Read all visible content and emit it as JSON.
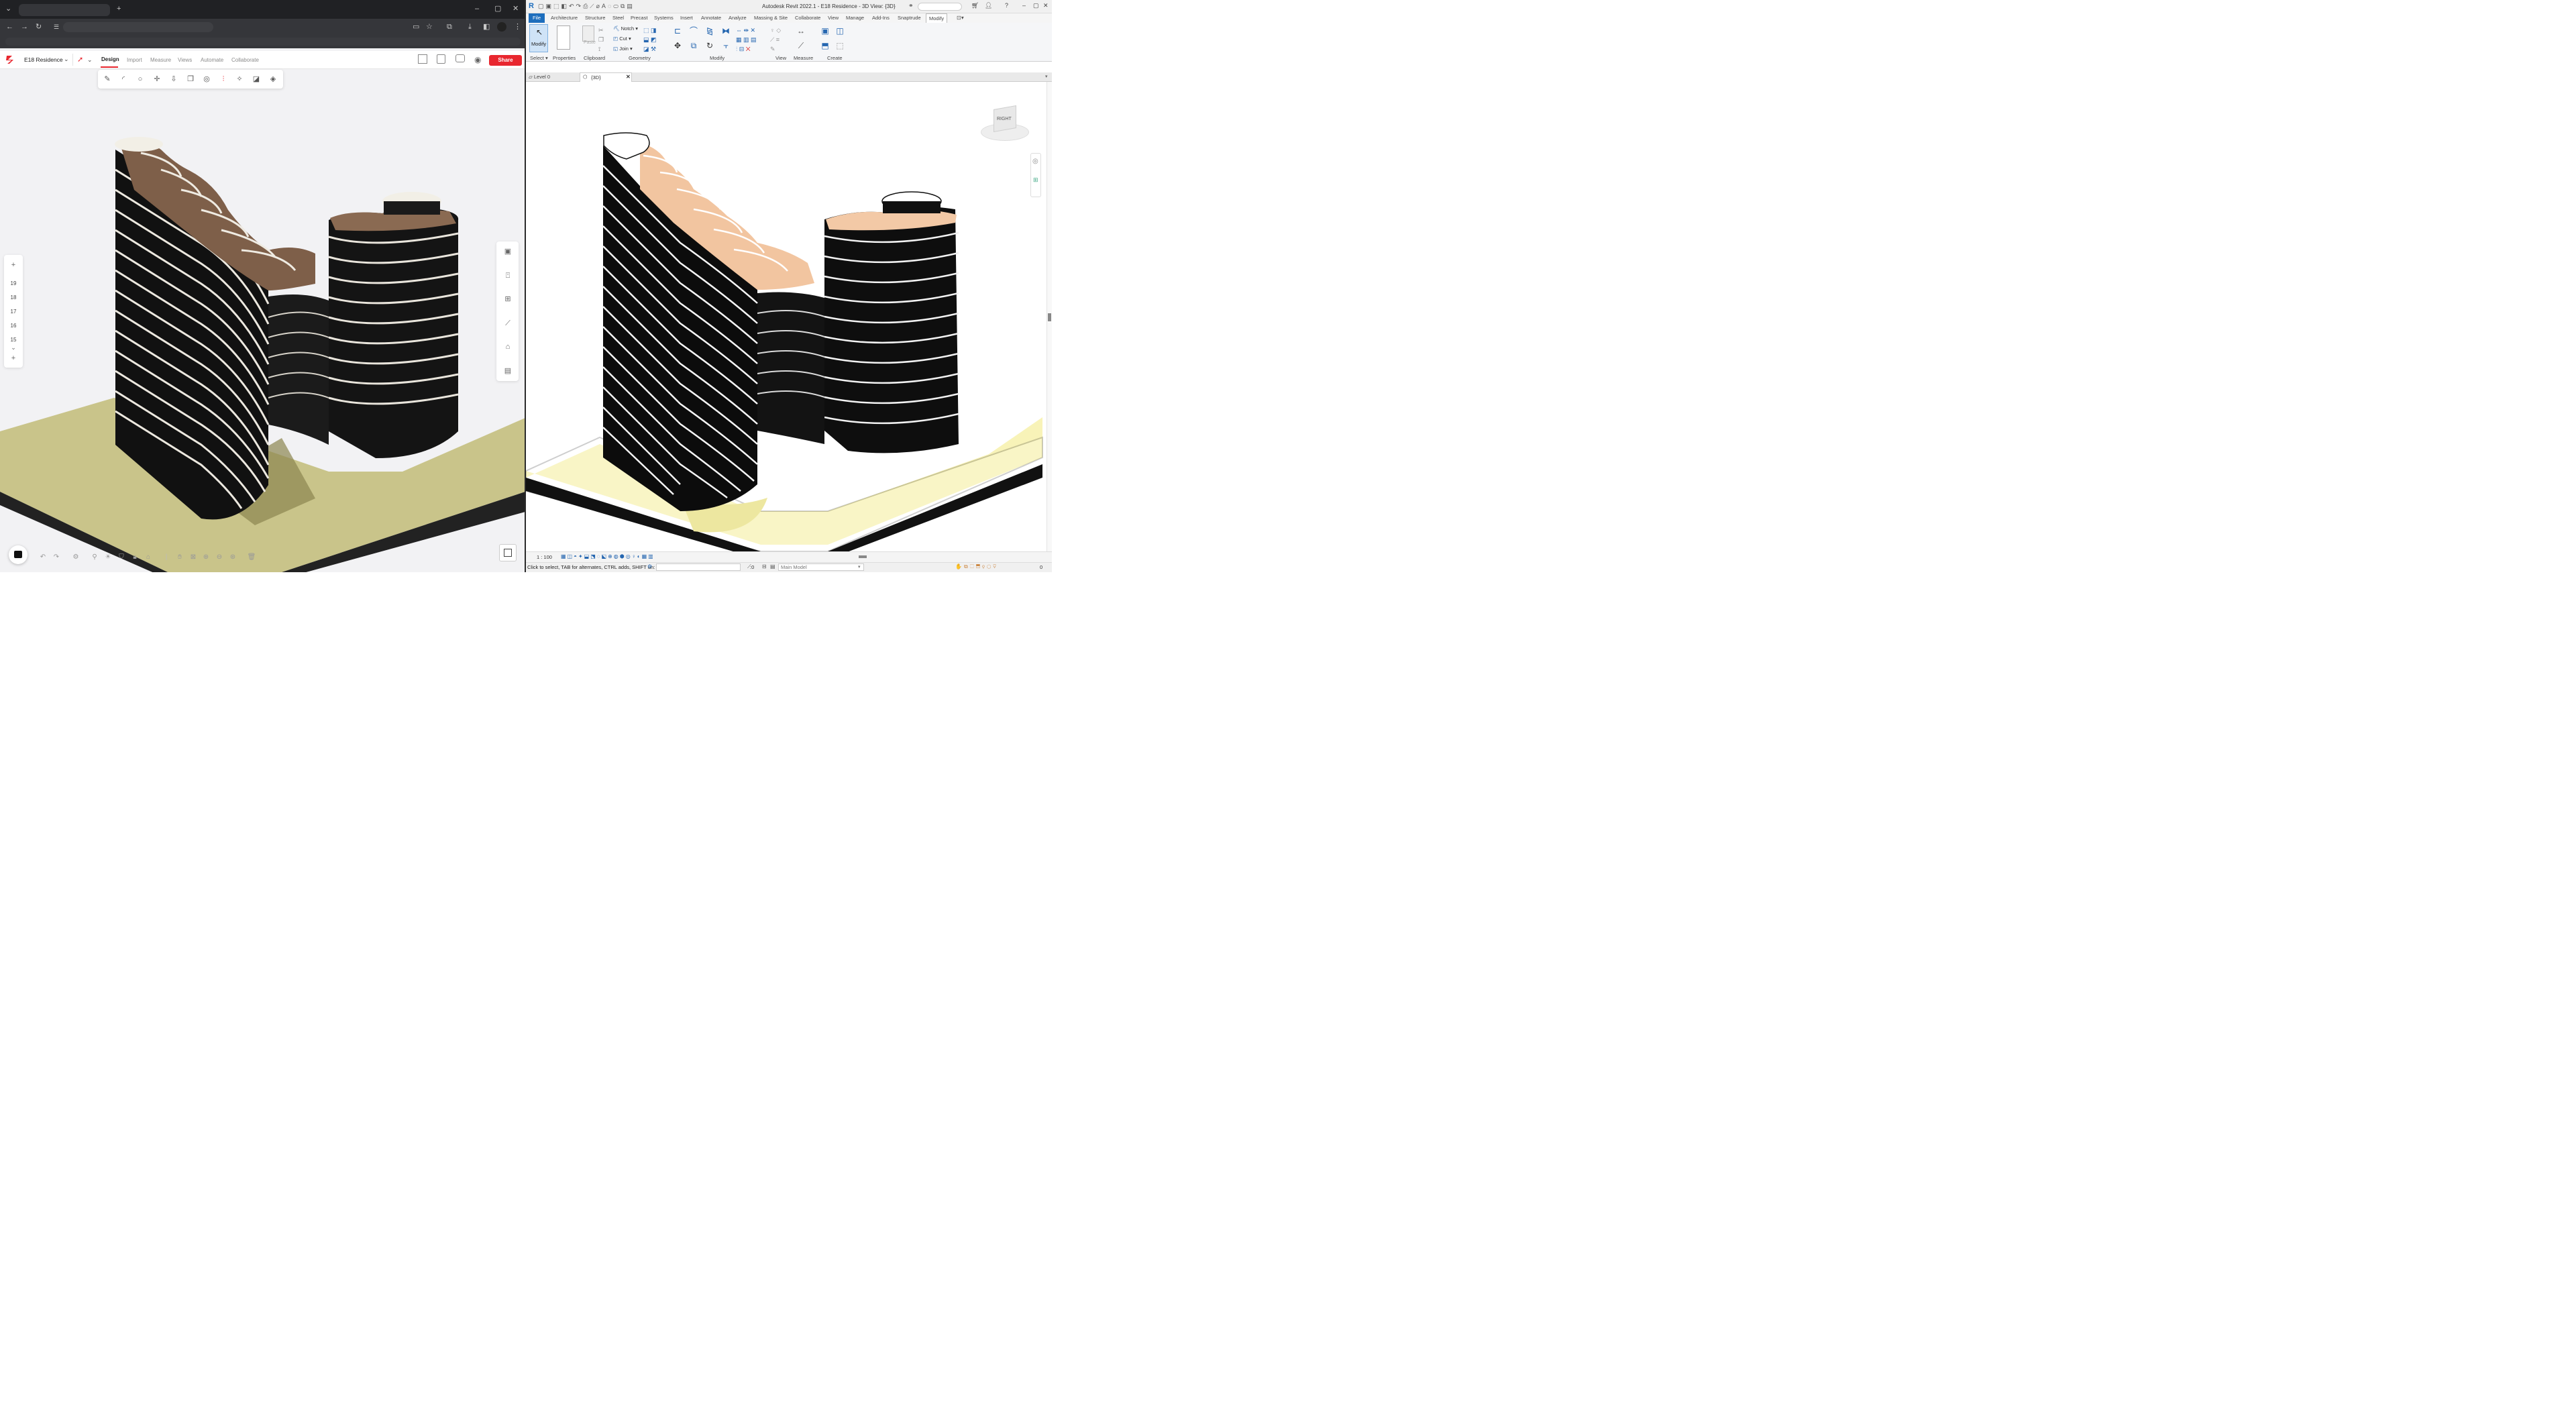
{
  "left_app": {
    "project_name": "E18 Residence",
    "menu": [
      "Design",
      "Import",
      "Measure",
      "Views",
      "Automate",
      "Collaborate"
    ],
    "active_menu": "Design",
    "share_label": "Share",
    "levels": [
      "19",
      "18",
      "17",
      "16",
      "15"
    ],
    "accent": "#e8272f",
    "toolbar_icons": [
      "pencil-icon",
      "arc-icon",
      "circle-icon",
      "move-icon",
      "push-pull-icon",
      "copy-icon",
      "offset-icon",
      "mirror-icon",
      "magic-icon",
      "section-icon",
      "material-icon"
    ],
    "right_panel_icons": [
      "floor-plan-icon",
      "elevator-icon",
      "grid-icon",
      "measure-icon",
      "sofa-icon",
      "document-icon"
    ]
  },
  "revit": {
    "title": "Autodesk Revit 2022.1 - E18 Residence - 3D View: {3D}",
    "ribbon_tabs": [
      "File",
      "Architecture",
      "Structure",
      "Steel",
      "Precast",
      "Systems",
      "Insert",
      "Annotate",
      "Analyze",
      "Massing & Site",
      "Collaborate",
      "View",
      "Manage",
      "Add-Ins",
      "Snaptrude",
      "Modify"
    ],
    "active_tab": "Modify",
    "groups": [
      "Select",
      "Properties",
      "Clipboard",
      "Geometry",
      "Modify",
      "View",
      "Measure",
      "Create"
    ],
    "modify_label": "Modify",
    "paste_label": "Paste",
    "geometry_items": [
      "Notch",
      "Cut",
      "Join"
    ],
    "view_tabs": [
      "Level 0",
      "{3D}"
    ],
    "viewcube_label": "RIGHT",
    "scale": "1 : 100",
    "status_text": "Click to select, TAB for alternates, CTRL adds, SHIFT un:",
    "status_right": ":0",
    "model_select": "Main Model",
    "accent": "#1e6ebd"
  }
}
